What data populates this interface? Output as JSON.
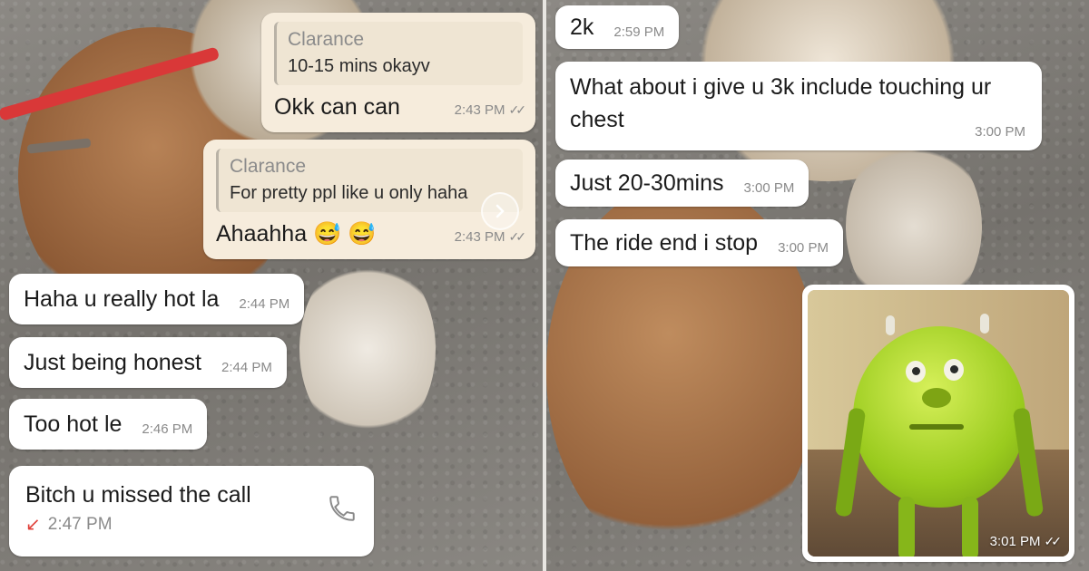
{
  "left_panel": {
    "out_quote_1": {
      "quote_author": "Clarance",
      "quote_text": "10-15 mins okayv",
      "text": "Okk can can",
      "time": "2:43 PM"
    },
    "out_quote_2": {
      "quote_author": "Clarance",
      "quote_text": "For pretty ppl like u only haha",
      "text": "Ahaahha",
      "emoji": "😅 😅",
      "time": "2:43 PM"
    },
    "incoming": [
      {
        "text": "Haha u really hot la",
        "time": "2:44 PM"
      },
      {
        "text": "Just being honest",
        "time": "2:44 PM"
      },
      {
        "text": "Too hot le",
        "time": "2:46 PM"
      }
    ],
    "missed_call": {
      "text": "Bitch u missed the call",
      "arrow": "↙",
      "time": "2:47 PM"
    }
  },
  "right_panel": {
    "incoming": [
      {
        "text": "2k",
        "time": "2:59 PM"
      },
      {
        "text": "What about i give u 3k include touching ur chest",
        "time": "3:00 PM"
      },
      {
        "text": "Just 20-30mins",
        "time": "3:00 PM"
      },
      {
        "text": "The ride end i stop",
        "time": "3:00 PM"
      }
    ],
    "sticker": {
      "time": "3:01 PM"
    }
  },
  "icons": {
    "read": "double-check-icon",
    "forward": "chevron-right-icon",
    "phone": "phone-icon",
    "missed": "missed-call-arrow-icon"
  },
  "colors": {
    "incoming_bubble": "#ffffff",
    "outgoing_bubble": "#f6ecdc",
    "missed_call": "#e0413a"
  }
}
